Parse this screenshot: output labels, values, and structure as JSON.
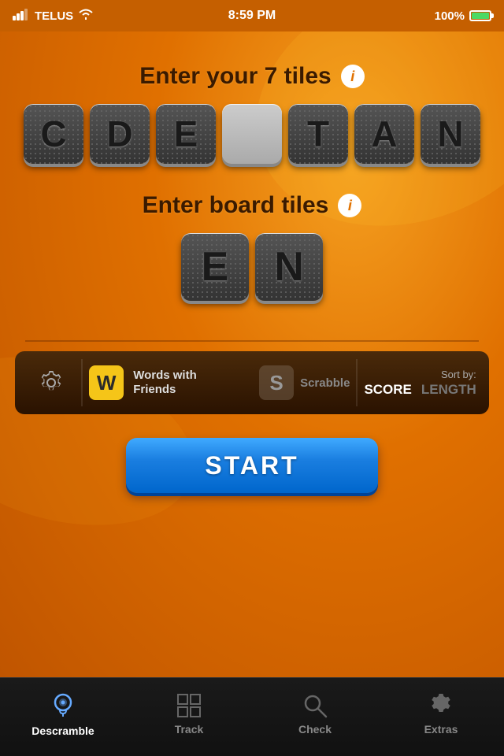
{
  "statusBar": {
    "carrier": "TELUS",
    "time": "8:59 PM",
    "battery": "100%"
  },
  "header": {
    "myTilesTitle": "Enter your 7 tiles",
    "boardTilesTitle": "Enter board tiles"
  },
  "myTiles": [
    "C",
    "D",
    "E",
    "",
    "T",
    "A",
    "N"
  ],
  "boardTiles": [
    "E",
    "N"
  ],
  "settingsBar": {
    "wwfBadge": "W",
    "wwfLabel": "Words with Friends",
    "scrabbleBadge": "S",
    "scrabbleLabel": "Scrabble",
    "sortLabel": "Sort by:",
    "sortScore": "SCORE",
    "sortLength": "LENGTH"
  },
  "startButton": "START",
  "tabs": [
    {
      "id": "descramble",
      "label": "Descramble",
      "active": true
    },
    {
      "id": "track",
      "label": "Track",
      "active": false
    },
    {
      "id": "check",
      "label": "Check",
      "active": false
    },
    {
      "id": "extras",
      "label": "Extras",
      "active": false
    }
  ]
}
